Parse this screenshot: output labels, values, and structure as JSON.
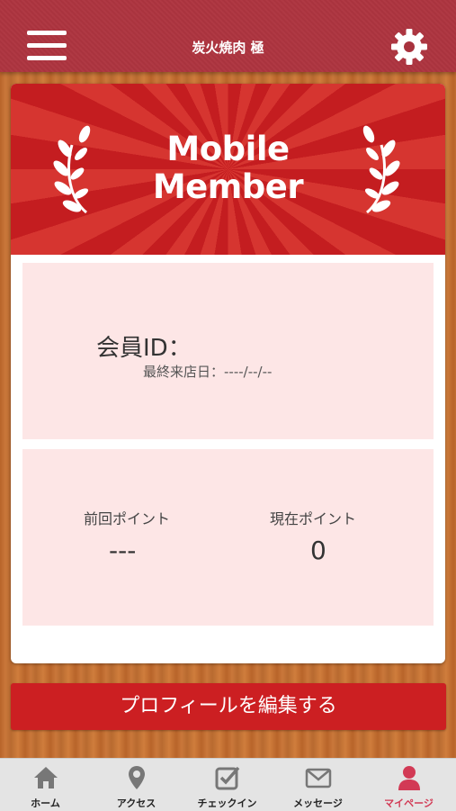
{
  "header": {
    "title": "炭火焼肉 極",
    "menu_icon": "hamburger-menu-icon",
    "settings_icon": "gear-icon"
  },
  "banner": {
    "line1": "Mobile",
    "line2": "Member",
    "decoration_icon": "laurel-wreath-icon"
  },
  "member": {
    "id_label": "会員ID：",
    "last_visit_label": "最終来店日：",
    "last_visit_value": "----/--/--"
  },
  "points": {
    "previous_label": "前回ポイント",
    "previous_value": "---",
    "current_label": "現在ポイント",
    "current_value": "0"
  },
  "edit_profile_label": "プロフィールを編集する",
  "tabs": [
    {
      "label": "ホーム",
      "icon": "home-icon"
    },
    {
      "label": "アクセス",
      "icon": "map-pin-icon"
    },
    {
      "label": "チェックイン",
      "icon": "checkbox-icon"
    },
    {
      "label": "メッセージ",
      "icon": "envelope-icon"
    },
    {
      "label": "マイページ",
      "icon": "person-icon"
    }
  ],
  "colors": {
    "header_bg": "#a8323d",
    "accent_red": "#cc1f22",
    "panel_pink": "#fde6e6",
    "active_tab": "#d23a55"
  }
}
